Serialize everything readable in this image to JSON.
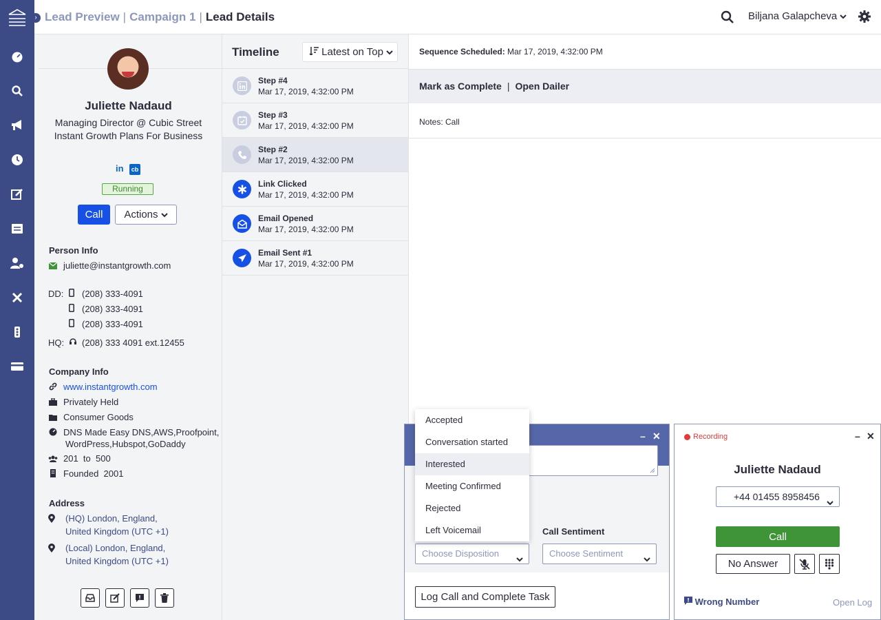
{
  "breadcrumbs": {
    "items": [
      "Lead Preview",
      "Campaign 1"
    ],
    "current": "Lead Details",
    "separator": "|"
  },
  "user": {
    "name": "Biljana Galapcheva"
  },
  "nav_icons": [
    "dashboard-icon",
    "search-icon",
    "megaphone-icon",
    "clock-icon",
    "edit-icon",
    "tasks-icon",
    "user-settings-icon",
    "tools-icon",
    "traffic-light-icon",
    "card-icon"
  ],
  "lead": {
    "name": "Juliette Nadaud",
    "title": "Managing Director @ Cubic Street Instant Growth Plans For Business",
    "status": "Running",
    "call_label": "Call",
    "actions_label": "Actions"
  },
  "person_info": {
    "title": "Person Info",
    "email": "juliette@instantgrowth.com",
    "dd_label": "DD:",
    "phones": [
      "(208) 333-4091",
      "(208) 333-4091",
      "(208) 333-4091"
    ],
    "hq_label": "HQ:",
    "hq_phone": "(208) 333 4091 ext.12455"
  },
  "company_info": {
    "title": "Company Info",
    "website": "www.instantgrowth.com",
    "ownership": "Privately Held",
    "industry": "Consumer Goods",
    "tech_line1": "DNS Made Easy DNS,AWS,Proofpoint,",
    "tech_line2": "WordPress,Hubspot,GoDaddy",
    "employees": "201  to  500",
    "founded": "Founded  2001"
  },
  "address": {
    "title": "Address",
    "hq_line1": "(HQ) London, England,",
    "hq_line2": "United Kingdom (UTC +1)",
    "local_line1": "(Local) London, England,",
    "local_line2": "United Kingdom (UTC +1)"
  },
  "timeline": {
    "title": "Timeline",
    "sort": "Latest on Top",
    "items": [
      {
        "title": "Step #4",
        "time": "Mar 17, 2019, 4:32:00 PM"
      },
      {
        "title": "Step #3",
        "time": "Mar 17, 2019, 4:32:00 PM"
      },
      {
        "title": "Step #2",
        "time": "Mar 17, 2019, 4:32:00 PM"
      },
      {
        "title": "Link Clicked",
        "time": "Mar 17, 2019, 4:32:00 PM"
      },
      {
        "title": "Email Opened",
        "time": "Mar 17, 2019, 4:32:00 PM"
      },
      {
        "title": "Email Sent #1",
        "time": "Mar 17, 2019, 4:32:00 PM"
      }
    ]
  },
  "detail": {
    "sequence_label": "Sequence Scheduled:",
    "sequence_time": "Mar 17, 2019, 4:32:00 PM",
    "mark_complete": "Mark as Complete",
    "open_dialer": "Open Dailer",
    "separator": "|",
    "notes": "Notes: Call"
  },
  "log_call": {
    "sentiment_label": "Call Sentiment",
    "disposition_placeholder": "Choose Disposition",
    "sentiment_placeholder": "Choose Sentiment",
    "submit_label": "Log Call and Complete Task",
    "disposition_options": [
      "Accepted",
      "Conversation started",
      "Interested",
      "Meeting Confirmed",
      "Rejected",
      "Left Voicemail"
    ],
    "highlighted_option": "Interested"
  },
  "dialer": {
    "recording": "Recording",
    "name": "Juliette Nadaud",
    "number": "+44 01455 8958456",
    "call_label": "Call",
    "no_answer_label": "No Answer",
    "wrong_number": "Wrong Number",
    "open_log": "Open Log"
  },
  "colors": {
    "nav": "#3c4b86",
    "primary": "#1650e5",
    "success": "#3f9438",
    "muted": "#8d97bd",
    "recording": "#e03b3b"
  }
}
